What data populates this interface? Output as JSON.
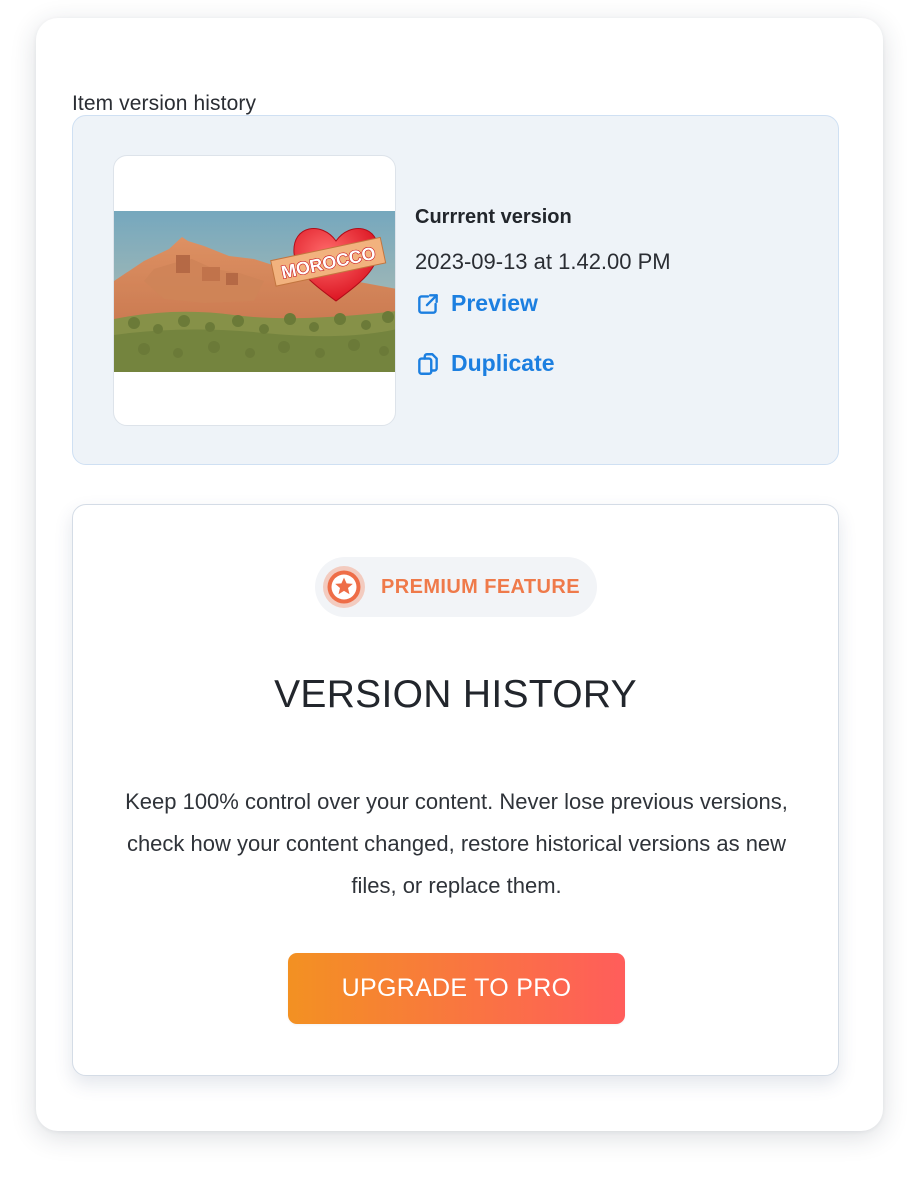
{
  "section": {
    "title": "Item version history"
  },
  "current_version": {
    "label": "Currrent version",
    "timestamp": "2023-09-13 at 1.42.00 PM",
    "thumbnail_text": "MOROCCO",
    "actions": [
      {
        "label": "Preview",
        "icon": "external-link-icon"
      },
      {
        "label": "Duplicate",
        "icon": "duplicate-icon"
      }
    ]
  },
  "promo": {
    "badge": {
      "label": "PREMIUM FEATURE",
      "icon": "star-badge-icon",
      "color": "#ef7a4a"
    },
    "title": "VERSION HISTORY",
    "description": "Keep 100% control over your content. Never lose previous versions, check how your content changed, restore historical versions as new files, or replace them.",
    "button": {
      "label": "UPGRADE TO PRO",
      "gradient_start": "#f39122",
      "gradient_end": "#ff5d5b"
    }
  },
  "colors": {
    "link": "#1c7fe0",
    "card_background": "#eef3f8",
    "card_border": "#cfe0f3"
  }
}
